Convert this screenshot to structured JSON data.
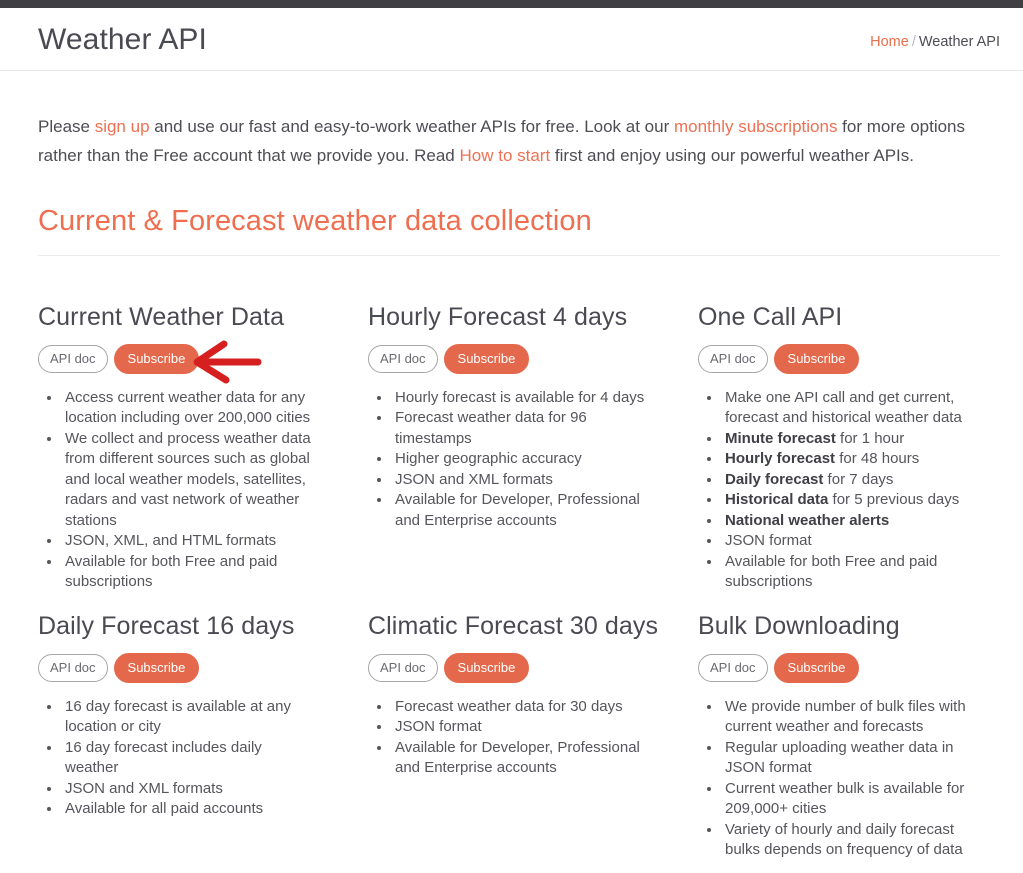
{
  "header": {
    "title": "Weather API",
    "breadcrumb": {
      "home": "Home",
      "separator": "/",
      "current": "Weather API"
    }
  },
  "intro": {
    "p1": "Please ",
    "link_signup": "sign up",
    "p2": " and use our fast and easy-to-work weather APIs for free. Look at our ",
    "link_subscriptions": "monthly subscriptions",
    "p3": " for more options rather than the Free account that we provide you. Read ",
    "link_howto": "How to start",
    "p4": " first and enjoy using our powerful weather APIs."
  },
  "section": {
    "heading": "Current & Forecast weather data collection"
  },
  "buttons": {
    "api_doc": "API doc",
    "subscribe": "Subscribe"
  },
  "colors": {
    "accent": "#ef6e4f",
    "subscribe_bg": "#e4694c",
    "link": "#ef7053",
    "title": "#4a4a52",
    "body_text": "#55555b",
    "top_strip": "#3f3f44",
    "annotation_arrow": "#d61f1f"
  },
  "annotation": {
    "arrow": "left-pointing-red-arrow",
    "points_to": "Subscribe button of Current Weather Data"
  },
  "cards": [
    {
      "title": "Current Weather Data",
      "items": [
        "Access current weather data for any location including over 200,000 cities",
        "We collect and process weather data from different sources such as global and local weather models, satellites, radars and vast network of weather stations",
        "JSON, XML, and HTML formats",
        "Available for both Free and paid subscriptions"
      ]
    },
    {
      "title": "Hourly Forecast 4 days",
      "items": [
        "Hourly forecast is available for 4 days",
        "Forecast weather data for 96 timestamps",
        "Higher geographic accuracy",
        "JSON and XML formats",
        "Available for Developer, Professional and Enterprise accounts"
      ]
    },
    {
      "title": "One Call API",
      "items_rich": [
        {
          "bold": "",
          "text": "Make one API call and get current, forecast and historical weather data"
        },
        {
          "bold": "Minute forecast",
          "text": " for 1 hour"
        },
        {
          "bold": "Hourly forecast",
          "text": " for 48 hours"
        },
        {
          "bold": "Daily forecast",
          "text": " for 7 days"
        },
        {
          "bold": "Historical data",
          "text": " for 5 previous days"
        },
        {
          "bold": "National weather alerts",
          "text": ""
        },
        {
          "bold": "",
          "text": "JSON format"
        },
        {
          "bold": "",
          "text": "Available for both Free and paid subscriptions"
        }
      ]
    },
    {
      "title": "Daily Forecast 16 days",
      "items": [
        "16 day forecast is available at any location or city",
        "16 day forecast includes daily weather",
        "JSON and XML formats",
        "Available for all paid accounts"
      ]
    },
    {
      "title": "Climatic Forecast 30 days",
      "items": [
        "Forecast weather data for 30 days",
        "JSON format",
        "Available for Developer, Professional and Enterprise accounts"
      ]
    },
    {
      "title": "Bulk Downloading",
      "items": [
        "We provide number of bulk files with current weather and forecasts",
        "Regular uploading weather data in JSON format",
        "Current weather bulk is available for 209,000+ cities",
        "Variety of hourly and daily forecast bulks depends on frequency of data"
      ]
    }
  ]
}
